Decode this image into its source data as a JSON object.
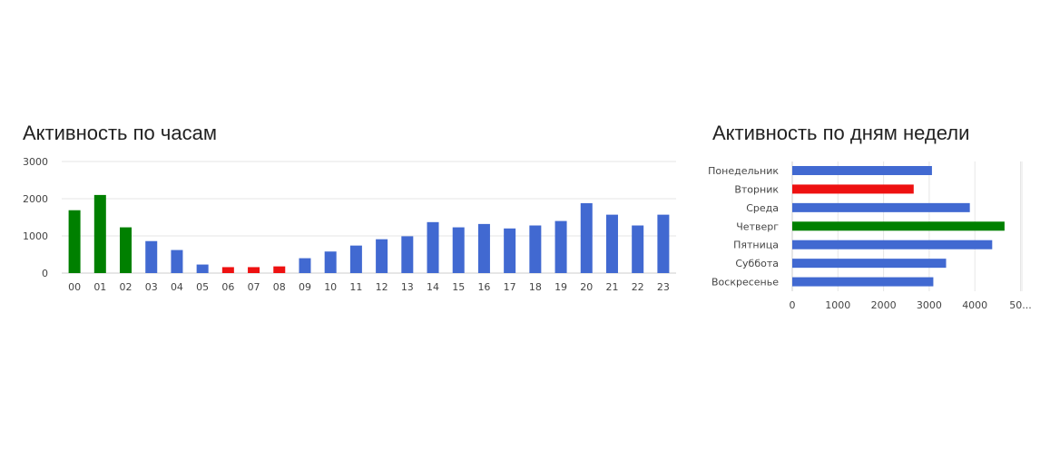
{
  "chart_data": [
    {
      "type": "bar",
      "title": "Активность по часам",
      "categories": [
        "00",
        "01",
        "02",
        "03",
        "04",
        "05",
        "06",
        "07",
        "08",
        "09",
        "10",
        "11",
        "12",
        "13",
        "14",
        "15",
        "16",
        "17",
        "18",
        "19",
        "20",
        "21",
        "22",
        "23"
      ],
      "values": [
        1690,
        2100,
        1230,
        860,
        620,
        230,
        160,
        160,
        180,
        400,
        580,
        740,
        910,
        990,
        1370,
        1230,
        1320,
        1200,
        1280,
        1400,
        1880,
        1570,
        1280,
        1570
      ],
      "colors": [
        "#008000",
        "#008000",
        "#008000",
        "#4169d1",
        "#4169d1",
        "#4169d1",
        "#ee1111",
        "#ee1111",
        "#ee1111",
        "#4169d1",
        "#4169d1",
        "#4169d1",
        "#4169d1",
        "#4169d1",
        "#4169d1",
        "#4169d1",
        "#4169d1",
        "#4169d1",
        "#4169d1",
        "#4169d1",
        "#4169d1",
        "#4169d1",
        "#4169d1",
        "#4169d1"
      ],
      "yticks": [
        "0",
        "1000",
        "2000",
        "3000"
      ],
      "ylim": [
        0,
        3000
      ],
      "grid": true
    },
    {
      "type": "bar",
      "orientation": "horizontal",
      "title": "Активность по дням недели",
      "categories": [
        "Понедельник",
        "Вторник",
        "Среда",
        "Четверг",
        "Пятница",
        "Суббота",
        "Воскресенье"
      ],
      "values": [
        3060,
        2660,
        3890,
        4650,
        4380,
        3370,
        3090
      ],
      "colors": [
        "#4169d1",
        "#ee1111",
        "#4169d1",
        "#008000",
        "#4169d1",
        "#4169d1",
        "#4169d1"
      ],
      "xticks": [
        "0",
        "1000",
        "2000",
        "3000",
        "4000",
        "50..."
      ],
      "xlim": [
        0,
        5000
      ],
      "grid": true
    }
  ]
}
